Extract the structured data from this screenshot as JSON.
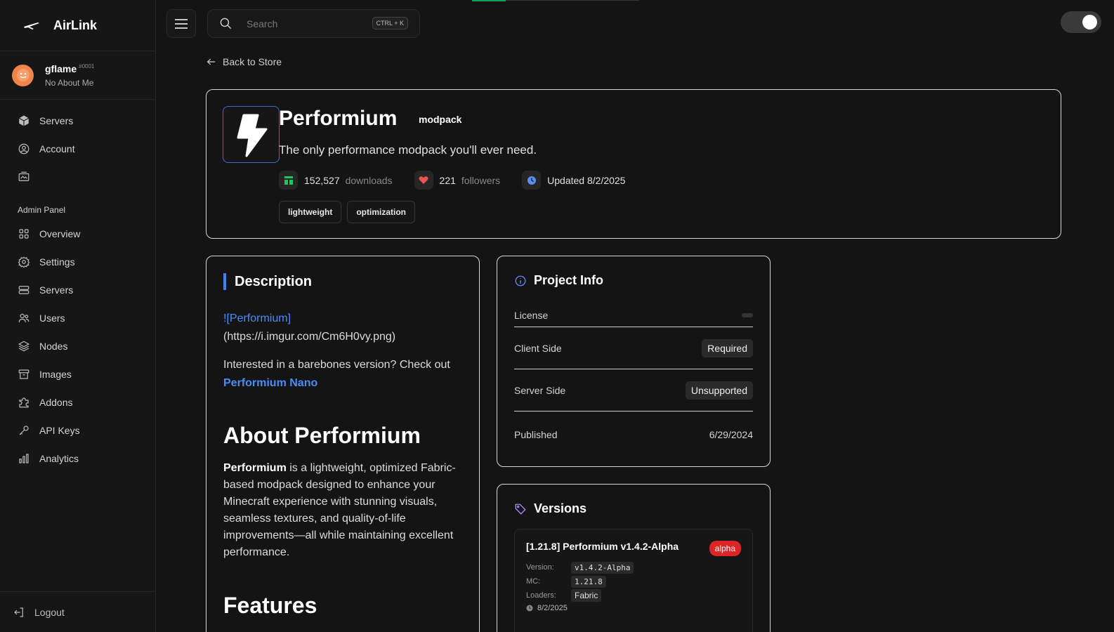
{
  "brand": {
    "name": "AirLink"
  },
  "user": {
    "name": "gflame",
    "tag": "#0001",
    "about": "No About Me"
  },
  "sidebar": {
    "main": [
      {
        "label": "Servers",
        "icon": "cube-icon"
      },
      {
        "label": "Account",
        "icon": "user-circle-icon"
      },
      {
        "label": "",
        "icon": "media-icon"
      }
    ],
    "admin_label": "Admin Panel",
    "admin": [
      {
        "label": "Overview",
        "icon": "grid-icon"
      },
      {
        "label": "Settings",
        "icon": "gear-icon"
      },
      {
        "label": "Servers",
        "icon": "server-icon"
      },
      {
        "label": "Users",
        "icon": "users-icon"
      },
      {
        "label": "Nodes",
        "icon": "layers-icon"
      },
      {
        "label": "Images",
        "icon": "archive-icon"
      },
      {
        "label": "Addons",
        "icon": "puzzle-icon"
      },
      {
        "label": "API Keys",
        "icon": "key-icon"
      },
      {
        "label": "Analytics",
        "icon": "bar-chart-icon"
      }
    ],
    "logout": "Logout"
  },
  "search": {
    "placeholder": "Search",
    "shortcut": "CTRL + K"
  },
  "back_link": "Back to Store",
  "project": {
    "title": "Performium",
    "type": "modpack",
    "tagline": "The only performance modpack you'll ever need.",
    "downloads": "152,527",
    "downloads_label": "downloads",
    "followers": "221",
    "followers_label": "followers",
    "updated": "Updated 8/2/2025",
    "tags": [
      "lightweight",
      "optimization"
    ]
  },
  "description": {
    "title": "Description",
    "img_prefix": "!",
    "img_link": "[Performium]",
    "img_suffix": "]",
    "img_url": "(https://i.imgur.com/Cm6H0vy.png)",
    "barebones_text": "Interested in a barebones version? Check out",
    "barebones_link": "Performium Nano",
    "about_heading": "About Performium",
    "about_bold": "Performium",
    "about_text": " is a lightweight, optimized Fabric-based modpack designed to enhance your Minecraft experience with stunning visuals, seamless textures, and quality-of-life improvements—all while maintaining excellent performance.",
    "features_heading": "Features"
  },
  "project_info": {
    "title": "Project Info",
    "rows": [
      {
        "label": "License",
        "value": ""
      },
      {
        "label": "Client Side",
        "value": "Required"
      },
      {
        "label": "Server Side",
        "value": "Unsupported"
      },
      {
        "label": "Published",
        "value": "6/29/2024"
      }
    ]
  },
  "versions": {
    "title": "Versions",
    "items": [
      {
        "name": "[1.21.8] Performium v1.4.2-Alpha",
        "channel": "alpha",
        "version_label": "Version:",
        "version": "v1.4.2-Alpha",
        "mc_label": "MC:",
        "mc": "1.21.8",
        "loaders_label": "Loaders:",
        "loaders": "Fabric",
        "date": "8/2/2025"
      }
    ]
  }
}
